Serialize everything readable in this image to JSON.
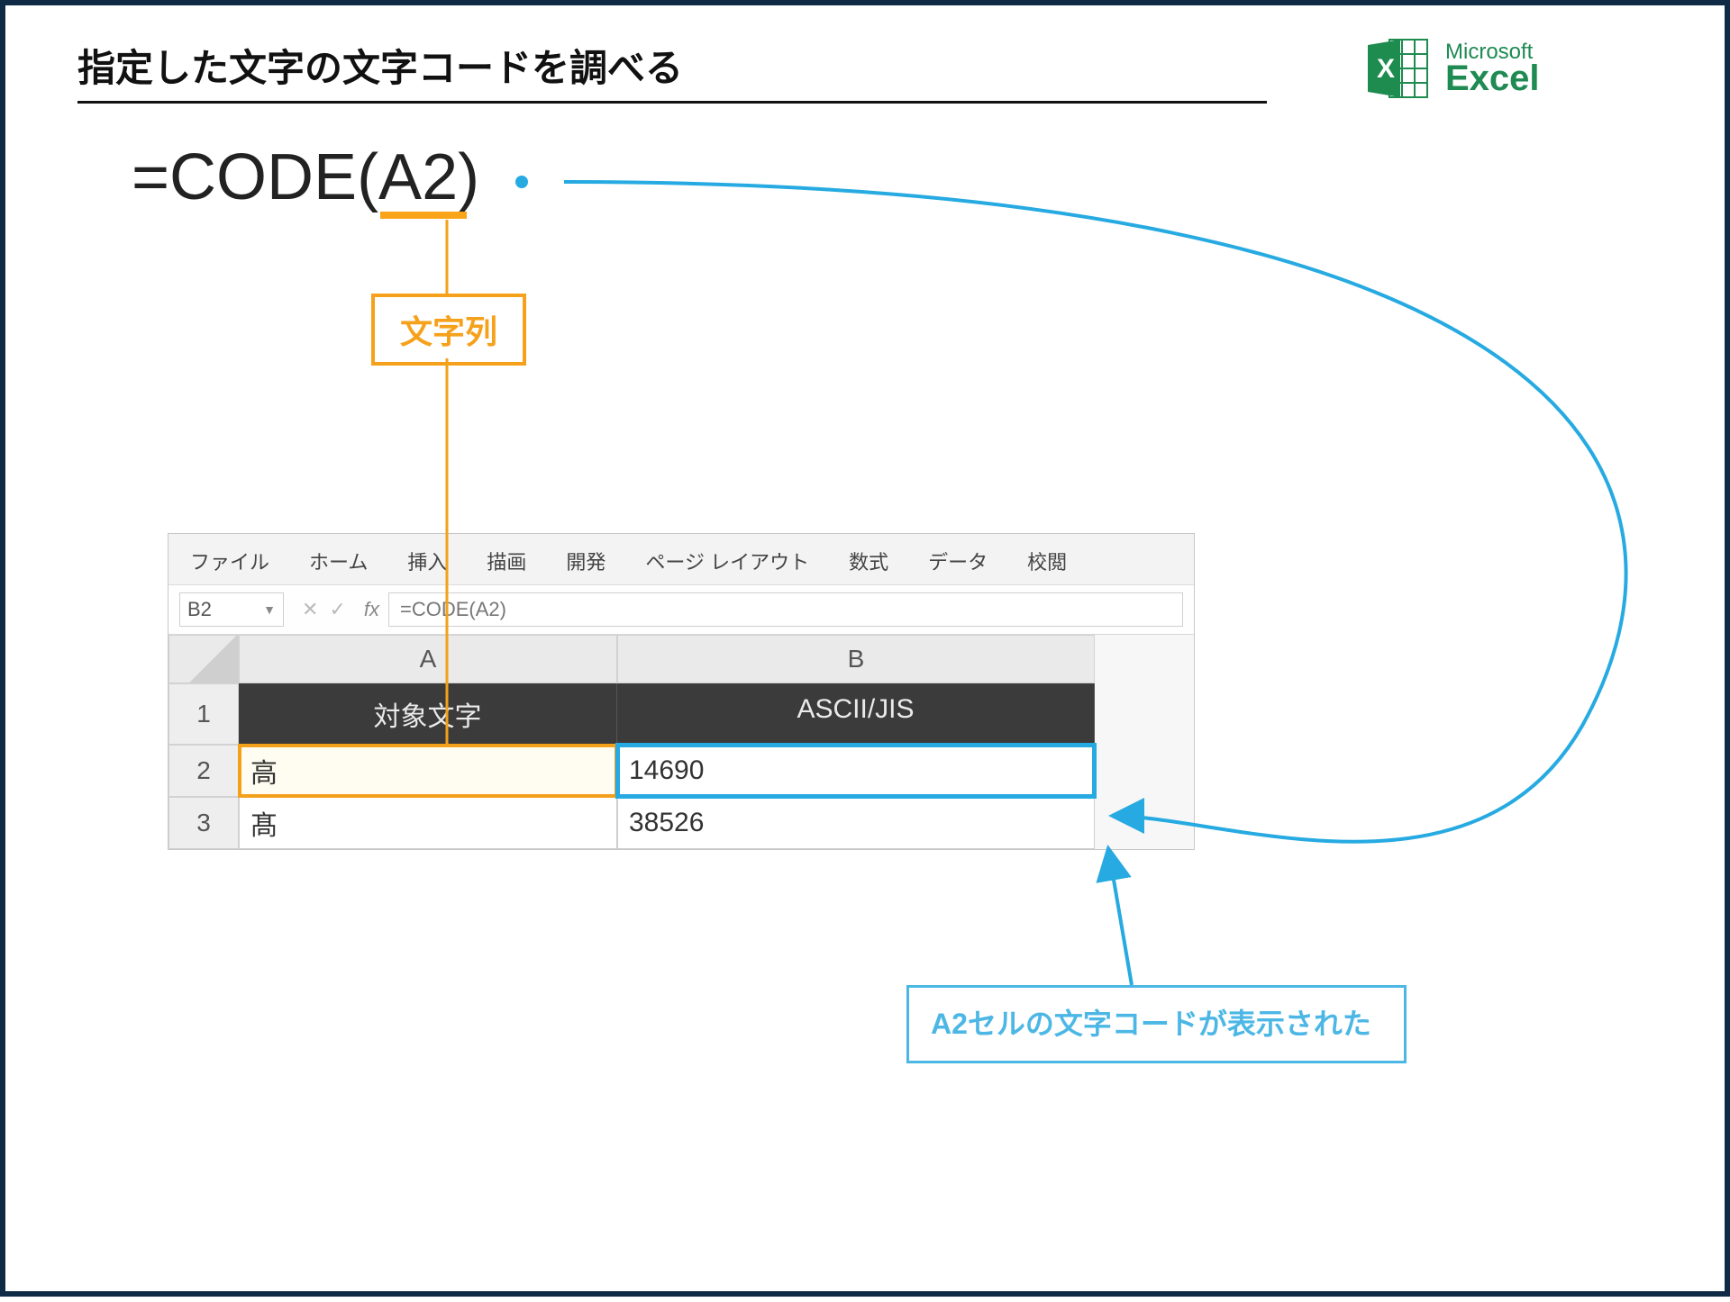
{
  "header": {
    "title": "指定した文字の文字コードを調べる",
    "logo": {
      "ms": "Microsoft",
      "ex": "Excel"
    }
  },
  "formula": {
    "prefix": "=CODE(",
    "arg": "A2",
    "suffix": ")"
  },
  "callouts": {
    "orange": "文字列",
    "blue": "A2セルの文字コードが表示された"
  },
  "excel": {
    "tabs": [
      "ファイル",
      "ホーム",
      "挿入",
      "描画",
      "開発",
      "ページ レイアウト",
      "数式",
      "データ",
      "校閲"
    ],
    "namebox": "B2",
    "fx_label": "fx",
    "formula_bar": "=CODE(A2)",
    "col_heads": [
      "A",
      "B"
    ],
    "row_heads": [
      "1",
      "2",
      "3"
    ],
    "header_row": [
      "対象文字",
      "ASCII/JIS"
    ],
    "rows": [
      {
        "a": "高",
        "b": "14690"
      },
      {
        "a": "髙",
        "b": "38526"
      }
    ]
  }
}
